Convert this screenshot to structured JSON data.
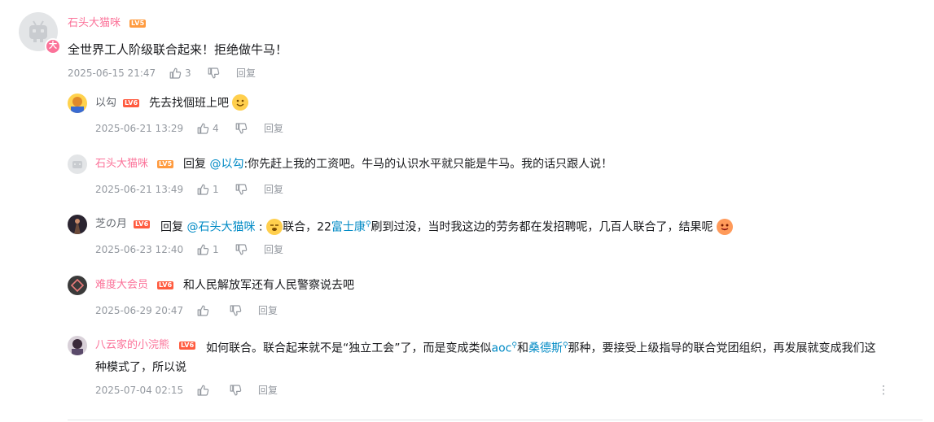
{
  "comment": {
    "username": "石头大猫咪",
    "level": "LV5",
    "badge": "大",
    "content": "全世界工人阶级联合起来！拒绝做牛马！",
    "time": "2025-06-15 21:47",
    "likes": "3",
    "reply_label": "回复"
  },
  "replies": [
    {
      "username": "以勾",
      "level": "LV6",
      "content": "先去找個班上吧",
      "time": "2025-06-21 13:29",
      "likes": "4",
      "reply_label": "回复"
    },
    {
      "username": "石头大猫咪",
      "level": "LV5",
      "reply_prefix": "回复",
      "mention": "@以勾",
      "content": ":你先赶上我的工资吧。牛马的认识水平就只能是牛马。我的话只跟人说！",
      "time": "2025-06-21 13:49",
      "likes": "1",
      "reply_label": "回复"
    },
    {
      "username": "芝の月",
      "level": "LV6",
      "reply_prefix": "回复",
      "mention": "@石头大猫咪",
      "content_sep": " :",
      "content_a": "联合，22",
      "link": "富士康",
      "content_b": "刷到过没，当时我这边的劳务都在发招聘呢，几百人联合了，结果呢",
      "time": "2025-06-23 12:40",
      "likes": "1",
      "reply_label": "回复"
    },
    {
      "username": "难度大会员",
      "level": "LV6",
      "content": "和人民解放军还有人民警察说去吧",
      "time": "2025-06-29 20:47",
      "likes": "",
      "reply_label": "回复"
    },
    {
      "username": "八云家的小浣熊",
      "level": "LV6",
      "content_a": "如何联合。联合起来就不是“独立工会”了，而是变成类似",
      "link1": "aoc",
      "content_b": "和",
      "link2": "桑德斯",
      "content_c": "那种，要接受上级指导的联合党团组织，再发展就变成我们这",
      "content_line2": "种模式了，所以说",
      "time": "2025-07-04 02:15",
      "likes": "",
      "reply_label": "回复"
    }
  ],
  "icons": {
    "like": "thumbs-up-icon",
    "dislike": "thumbs-down-icon",
    "search": "search-superscript-icon",
    "more": "more-vertical-icon"
  },
  "colors": {
    "username_pink": "#fb7299",
    "link_blue": "#008ac5",
    "meta_gray": "#9499a0",
    "lv5": "#ff9b3f",
    "lv6": "#ff5b3f"
  }
}
